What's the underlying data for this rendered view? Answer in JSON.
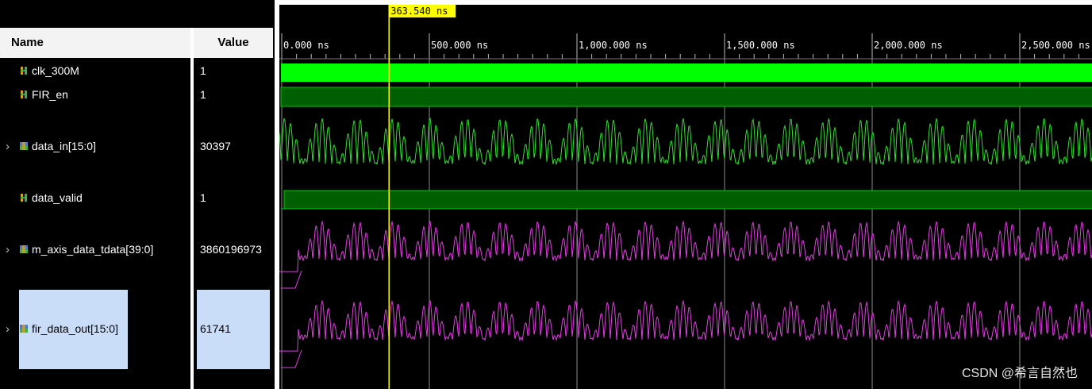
{
  "columns": {
    "name": "Name",
    "value": "Value"
  },
  "signals": [
    {
      "name": "clk_300M",
      "value": "1",
      "icon": "scalar-signal-icon",
      "expandable": false
    },
    {
      "name": "FIR_en",
      "value": "1",
      "icon": "scalar-signal-icon",
      "expandable": false
    },
    {
      "name": "data_in[15:0]",
      "value": "30397",
      "icon": "bus-signal-icon",
      "expandable": true
    },
    {
      "name": "data_valid",
      "value": "1",
      "icon": "scalar-signal-icon",
      "expandable": false
    },
    {
      "name": "m_axis_data_tdata[39:0]",
      "value": "3860196973",
      "icon": "bus-signal-icon",
      "expandable": true
    },
    {
      "name": "fir_data_out[15:0]",
      "value": "61741",
      "icon": "bus-signal-icon",
      "expandable": true,
      "selected": true
    }
  ],
  "timeline": {
    "cursor_label": "363.540 ns",
    "cursor_time_ns": 363.54,
    "tick_labels": [
      "0.000 ns",
      "500.000 ns",
      "1,000.000 ns",
      "1,500.000 ns",
      "2,000.000 ns",
      "2,500.000 ns"
    ],
    "tick_values_ns": [
      0,
      500,
      1000,
      1500,
      2000,
      2500
    ]
  },
  "colors": {
    "clock": "#00ff00",
    "bus_fill": "#005f00",
    "bus_edge": "#00c800",
    "analog_in": "#33dd33",
    "analog_out": "#e040e0",
    "cursor": "#ffff00",
    "selection": "#c9dcf8"
  },
  "watermark": "CSDN @希言自然也"
}
